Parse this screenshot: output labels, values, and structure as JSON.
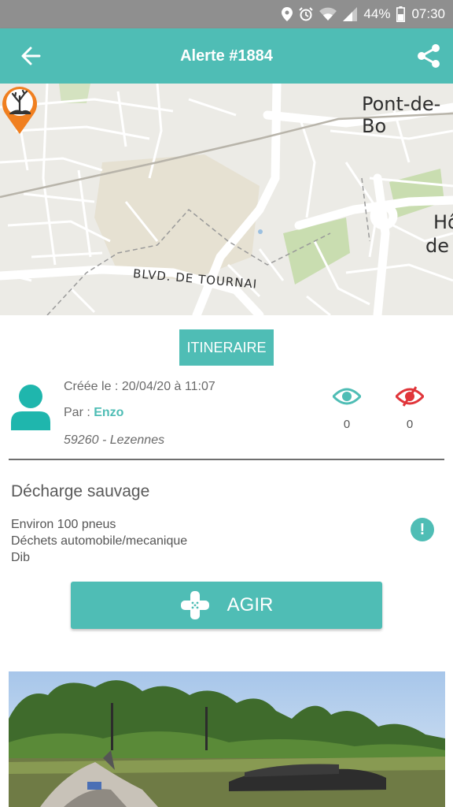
{
  "status_bar": {
    "battery": "44%",
    "time": "07:30",
    "icons": [
      "location-icon",
      "alarm-icon",
      "wifi-icon",
      "signal-icon",
      "battery-icon"
    ]
  },
  "app_bar": {
    "title": "Alerte #1884",
    "back_icon": "arrow-left-icon",
    "share_icon": "share-icon"
  },
  "map": {
    "labels": {
      "town_top": "Pont-de-Bo",
      "town_right_1": "Hô",
      "town_right_2": "de",
      "street": "BLVD. DE TOURNAI"
    },
    "marker_icon": "dead-tree-marker-icon"
  },
  "actions": {
    "itinerary_label": "ITINERAIRE",
    "act_label": "AGIR"
  },
  "alert": {
    "created": "Créée le : 20/04/20 à 11:07",
    "author_prefix": "Par : ",
    "author_name": "Enzo",
    "location": "59260 - Lezennes",
    "seen_count": "0",
    "unseen_count": "0",
    "category": "Décharge sauvage",
    "description": [
      "Environ 100 pneus",
      "Déchets automobile/mecanique",
      "Dib"
    ]
  },
  "colors": {
    "accent": "#4fbdb5",
    "status_bar": "#8f8f8f",
    "marker": "#f07f1f",
    "unseen": "#e0353a"
  }
}
